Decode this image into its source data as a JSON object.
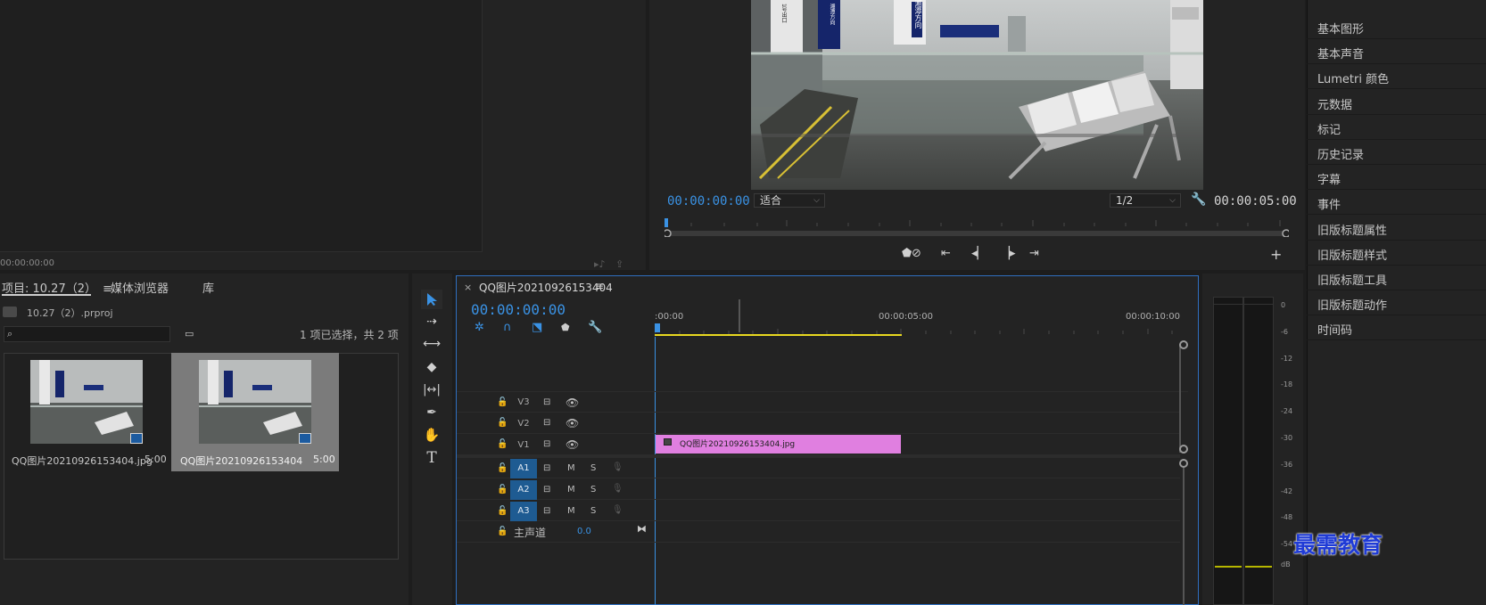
{
  "source_monitor": {
    "timecode": "00:00:00:00"
  },
  "program_monitor": {
    "timecode": "00:00:00:00",
    "fit_dropdown": "适合",
    "resolution_dropdown": "1/2",
    "duration": "00:00:05:00",
    "video_signs": {
      "main_sign": "湘潭方向",
      "side_sign": "湘潭方向",
      "top_sign": "1号出口"
    }
  },
  "right_panel": {
    "items": [
      "基本图形",
      "基本声音",
      "Lumetri 颜色",
      "元数据",
      "标记",
      "历史记录",
      "字幕",
      "事件",
      "旧版标题属性",
      "旧版标题样式",
      "旧版标题工具",
      "旧版标题动作",
      "时间码"
    ]
  },
  "project_panel": {
    "tabs": {
      "project": "项目: 10.27（2）",
      "media_browser": "媒体浏览器",
      "library": "库"
    },
    "project_file": "10.27（2）.prproj",
    "search_placeholder": "",
    "selection_info": "1 项已选择，共 2 项",
    "clips": [
      {
        "name": "QQ图片20210926153404.jpg",
        "duration": "5:00"
      },
      {
        "name": "QQ图片20210926153404",
        "duration": "5:00"
      }
    ]
  },
  "timeline": {
    "sequence_name": "QQ图片20210926153404",
    "timecode": "00:00:00:00",
    "ruler_labels": [
      ":00:00",
      "00:00:05:00",
      "00:00:10:00"
    ],
    "video_tracks": [
      "V3",
      "V2",
      "V1"
    ],
    "audio_tracks": [
      "A1",
      "A2",
      "A3"
    ],
    "mute_label": "M",
    "solo_label": "S",
    "master_label": "主声道",
    "master_value": "0.0",
    "clip_label": "QQ图片20210926153404.jpg",
    "clip_color": "#e07fe0"
  },
  "meters": {
    "db_labels": [
      "0",
      "-6",
      "-12",
      "-18",
      "-24",
      "-30",
      "-36",
      "-42",
      "-48",
      "-54",
      "dB"
    ]
  },
  "watermark": "最需教育"
}
